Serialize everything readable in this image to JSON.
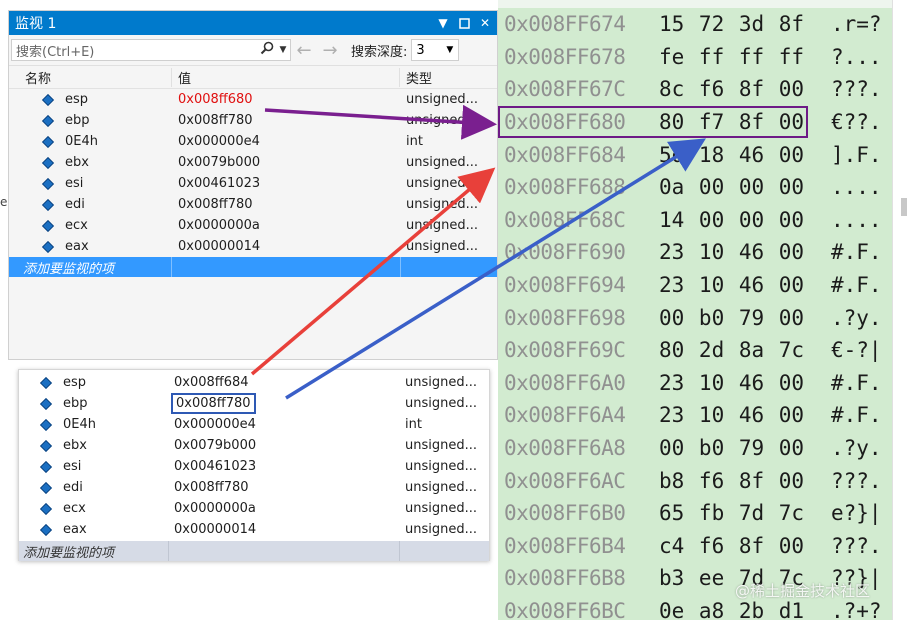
{
  "watch": {
    "title": "监视 1",
    "search_placeholder": "搜索(Ctrl+E)",
    "depth_label": "搜索深度:",
    "depth_value": "3",
    "columns": {
      "name": "名称",
      "value": "值",
      "type": "类型"
    },
    "rows": [
      {
        "name": "esp",
        "value": "0x008ff680",
        "type": "unsigned..."
      },
      {
        "name": "ebp",
        "value": "0x008ff780",
        "type": "unsigned..."
      },
      {
        "name": "0E4h",
        "value": "0x000000e4",
        "type": "int"
      },
      {
        "name": "ebx",
        "value": "0x0079b000",
        "type": "unsigned..."
      },
      {
        "name": "esi",
        "value": "0x00461023",
        "type": "unsigned..."
      },
      {
        "name": "edi",
        "value": "0x008ff780",
        "type": "unsigned..."
      },
      {
        "name": "ecx",
        "value": "0x0000000a",
        "type": "unsigned..."
      },
      {
        "name": "eax",
        "value": "0x00000014",
        "type": "unsigned..."
      }
    ],
    "add_item": "添加要监视的项",
    "highlight_color": "#e01010"
  },
  "watch_prev": {
    "rows": [
      {
        "name": "esp",
        "value": "0x008ff684",
        "type": "unsigned..."
      },
      {
        "name": "ebp",
        "value": "0x008ff780",
        "type": "unsigned..."
      },
      {
        "name": "0E4h",
        "value": "0x000000e4",
        "type": "int"
      },
      {
        "name": "ebx",
        "value": "0x0079b000",
        "type": "unsigned..."
      },
      {
        "name": "esi",
        "value": "0x00461023",
        "type": "unsigned..."
      },
      {
        "name": "edi",
        "value": "0x008ff780",
        "type": "unsigned..."
      },
      {
        "name": "ecx",
        "value": "0x0000000a",
        "type": "unsigned..."
      },
      {
        "name": "eax",
        "value": "0x00000014",
        "type": "unsigned..."
      }
    ],
    "add_item": "添加要监视的项"
  },
  "memory": {
    "rows": [
      {
        "addr": "0x008FF674",
        "bytes": "15 72 3d 8f",
        "ascii": ".r=?"
      },
      {
        "addr": "0x008FF678",
        "bytes": "fe ff ff ff",
        "ascii": "?..."
      },
      {
        "addr": "0x008FF67C",
        "bytes": "8c f6 8f 00",
        "ascii": "???."
      },
      {
        "addr": "0x008FF680",
        "bytes": "80 f7 8f 00",
        "ascii": "€??."
      },
      {
        "addr": "0x008FF684",
        "bytes": "5d 18 46 00",
        "ascii": "].F."
      },
      {
        "addr": "0x008FF688",
        "bytes": "0a 00 00 00",
        "ascii": "...."
      },
      {
        "addr": "0x008FF68C",
        "bytes": "14 00 00 00",
        "ascii": "...."
      },
      {
        "addr": "0x008FF690",
        "bytes": "23 10 46 00",
        "ascii": "#.F."
      },
      {
        "addr": "0x008FF694",
        "bytes": "23 10 46 00",
        "ascii": "#.F."
      },
      {
        "addr": "0x008FF698",
        "bytes": "00 b0 79 00",
        "ascii": ".?y."
      },
      {
        "addr": "0x008FF69C",
        "bytes": "80 2d 8a 7c",
        "ascii": "€-?|"
      },
      {
        "addr": "0x008FF6A0",
        "bytes": "23 10 46 00",
        "ascii": "#.F."
      },
      {
        "addr": "0x008FF6A4",
        "bytes": "23 10 46 00",
        "ascii": "#.F."
      },
      {
        "addr": "0x008FF6A8",
        "bytes": "00 b0 79 00",
        "ascii": ".?y."
      },
      {
        "addr": "0x008FF6AC",
        "bytes": "b8 f6 8f 00",
        "ascii": "???."
      },
      {
        "addr": "0x008FF6B0",
        "bytes": "65 fb 7d 7c",
        "ascii": "e?}|"
      },
      {
        "addr": "0x008FF6B4",
        "bytes": "c4 f6 8f 00",
        "ascii": "???."
      },
      {
        "addr": "0x008FF6B8",
        "bytes": "b3 ee 7d 7c",
        "ascii": "??}|"
      },
      {
        "addr": "0x008FF6BC",
        "bytes": "0e a8 2b d1",
        "ascii": ".?+?"
      }
    ],
    "highlight_row": 3,
    "highlight_color": "#6e1a86",
    "bg_color": "#d2ebd0"
  },
  "annotations": {
    "purple": "#7a1f8f",
    "red": "#e8403a",
    "blue": "#3a5fc8"
  },
  "watermark": "@稀土掘金技术社区",
  "side_fragment": "es"
}
